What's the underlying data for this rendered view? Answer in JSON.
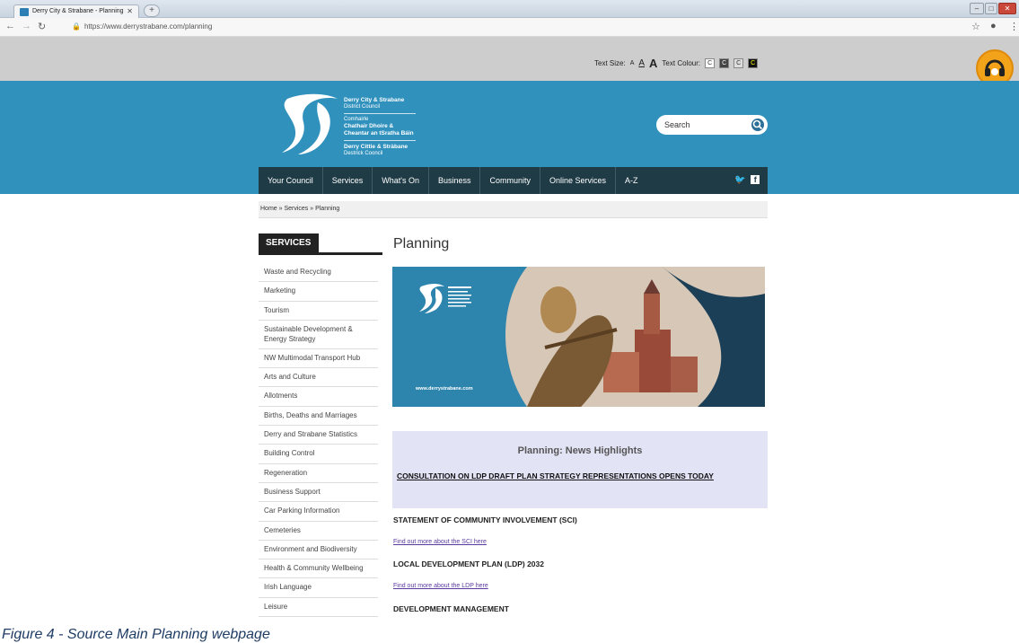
{
  "browser": {
    "tab_title": "Derry City & Strabane - Planning",
    "url": "https://www.derrystrabane.com/planning"
  },
  "utility": {
    "text_size_label": "Text Size:",
    "size_small": "A",
    "size_medium": "A",
    "size_large": "A",
    "text_colour_label": "Text Colour:",
    "colour_options": [
      "C",
      "C",
      "C",
      "C"
    ]
  },
  "header": {
    "logo_lines": {
      "name1": "Derry City & Strabane",
      "sub1": "District Council",
      "irish_small": "Comhairle",
      "irish1": "Chathair Dhoire &",
      "irish2": "Cheantar an tSratha Báin",
      "ulster1": "Derry Cittie & Stràbane",
      "ulster_sub": "Destrick Cooncil"
    },
    "search_placeholder": "Search"
  },
  "nav": {
    "items": [
      "Your Council",
      "Services",
      "What's On",
      "Business",
      "Community",
      "Online Services",
      "A-Z"
    ]
  },
  "breadcrumb": "Home » Services » Planning",
  "sidebar": {
    "heading": "SERVICES",
    "items": [
      "Waste and Recycling",
      "Marketing",
      "Tourism",
      "Sustainable Development & Energy Strategy",
      "NW Multimodal Transport Hub",
      "Arts and Culture",
      "Allotments",
      "Births, Deaths and Marriages",
      "Derry and Strabane Statistics",
      "Building Control",
      "Regeneration",
      "Business Support",
      "Car Parking Information",
      "Cemeteries",
      "Environment and Biodiversity",
      "Health & Community Wellbeing",
      "Irish Language",
      "Leisure"
    ]
  },
  "main": {
    "title": "Planning",
    "banner_url": "www.derrystrabane.com",
    "news_title": "Planning: News Highlights",
    "news_link": "CONSULTATION ON LDP DRAFT PLAN STRATEGY REPRESENTATIONS OPENS TODAY",
    "sections": [
      {
        "heading": "STATEMENT OF COMMUNITY INVOLVEMENT (SCI)",
        "link": "Find out more about the SCI here"
      },
      {
        "heading": "LOCAL DEVELOPMENT PLAN (LDP) 2032",
        "link": "Find out more about the LDP here"
      },
      {
        "heading": "DEVELOPMENT MANAGEMENT",
        "link": ""
      }
    ]
  },
  "caption": "Figure 4 - Source Main Planning webpage",
  "colors": {
    "masthead": "#3191bd",
    "nav": "#1f3b46",
    "news_bg": "#e3e3f6",
    "helper": "#f2a31a"
  }
}
